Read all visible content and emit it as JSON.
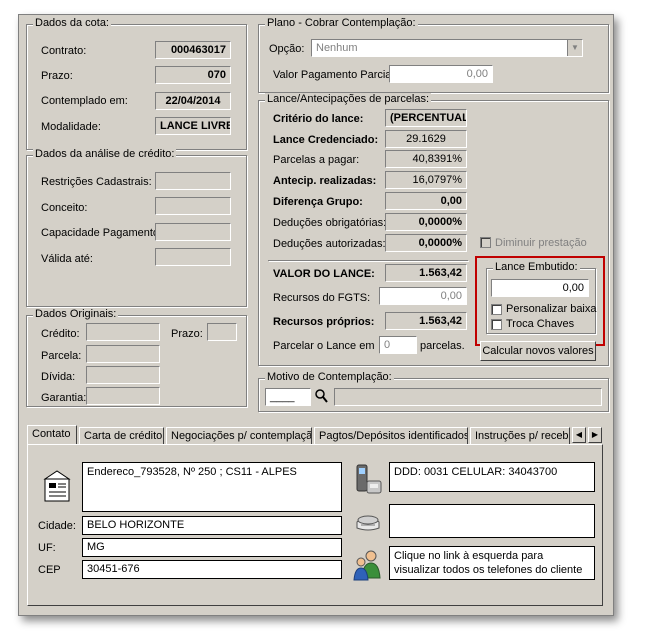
{
  "dados_cota": {
    "title": "Dados da cota:",
    "contrato_label": "Contrato:",
    "contrato": "000463017",
    "prazo_label": "Prazo:",
    "prazo": "070",
    "contemplado_label": "Contemplado em:",
    "contemplado": "22/04/2014",
    "modalidade_label": "Modalidade:",
    "modalidade": "LANCE LIVRE"
  },
  "analise_credito": {
    "title": "Dados da análise de crédito:",
    "restricoes_label": "Restrições Cadastrais:",
    "conceito_label": "Conceito:",
    "capacidade_label": "Capacidade Pagamento:",
    "valida_label": "Válida até:"
  },
  "dados_originais": {
    "title": "Dados Originais:",
    "credito_label": "Crédito:",
    "prazo_label": "Prazo:",
    "parcela_label": "Parcela:",
    "divida_label": "Dívida:",
    "garantia_label": "Garantia:"
  },
  "plano": {
    "title": "Plano - Cobrar Contemplação:",
    "opcao_label": "Opção:",
    "opcao_value": "Nenhum",
    "valor_label": "Valor Pagamento Parcial:",
    "valor_value": "0,00"
  },
  "lance": {
    "title": "Lance/Antecipações de parcelas:",
    "criterio_label": "Critério do lance:",
    "criterio": "(PERCENTUAL)",
    "credenciado_label": "Lance Credenciado:",
    "credenciado": "29.1629",
    "parcelas_label": "Parcelas a pagar:",
    "parcelas": "40,8391%",
    "antecip_label": "Antecip. realizadas:",
    "antecip": "16,0797%",
    "diferenca_label": "Diferença Grupo:",
    "diferenca": "0,00",
    "ded_obrig_label": "Deduções obrigatórias:",
    "ded_obrig": "0,0000%",
    "ded_autor_label": "Deduções autorizadas:",
    "ded_autor": "0,0000%",
    "diminuir_label": "Diminuir prestação",
    "valor_lance_label": "VALOR DO LANCE:",
    "valor_lance": "1.563,42",
    "fgts_label": "Recursos do FGTS:",
    "fgts": "0,00",
    "proprios_label": "Recursos próprios:",
    "proprios": "1.563,42",
    "parcelar_label": "Parcelar o Lance em",
    "parcelar_value": "0",
    "parcelas_suffix": "parcelas."
  },
  "lance_embutido": {
    "title": "Lance Embutido:",
    "value": "0,00",
    "personalizar_label": "Personalizar baixa",
    "troca_label": "Troca Chaves",
    "calcular_button": "Calcular novos valores"
  },
  "motivo": {
    "title": "Motivo de Contemplação:",
    "code": "____"
  },
  "tabs": [
    {
      "label": "Contato"
    },
    {
      "label": "Carta de crédito"
    },
    {
      "label": "Negociações p/ contemplação"
    },
    {
      "label": "Pagtos/Depósitos identificados"
    },
    {
      "label": "Instruções p/ recebim"
    }
  ],
  "contato": {
    "endereco": "Endereco_793528, Nº 250 ; CS11 - ALPES",
    "cidade_label": "Cidade:",
    "cidade": "BELO HORIZONTE",
    "uf_label": "UF:",
    "uf": "MG",
    "cep_label": "CEP",
    "cep": "30451-676",
    "telefone": "DDD: 0031  CELULAR: 34043700",
    "telefones_info": "Clique no link à esquerda para visualizar todos os telefones do cliente"
  },
  "colors": {
    "window_bg": "#d4d0c8",
    "highlight_border": "#c00000"
  }
}
